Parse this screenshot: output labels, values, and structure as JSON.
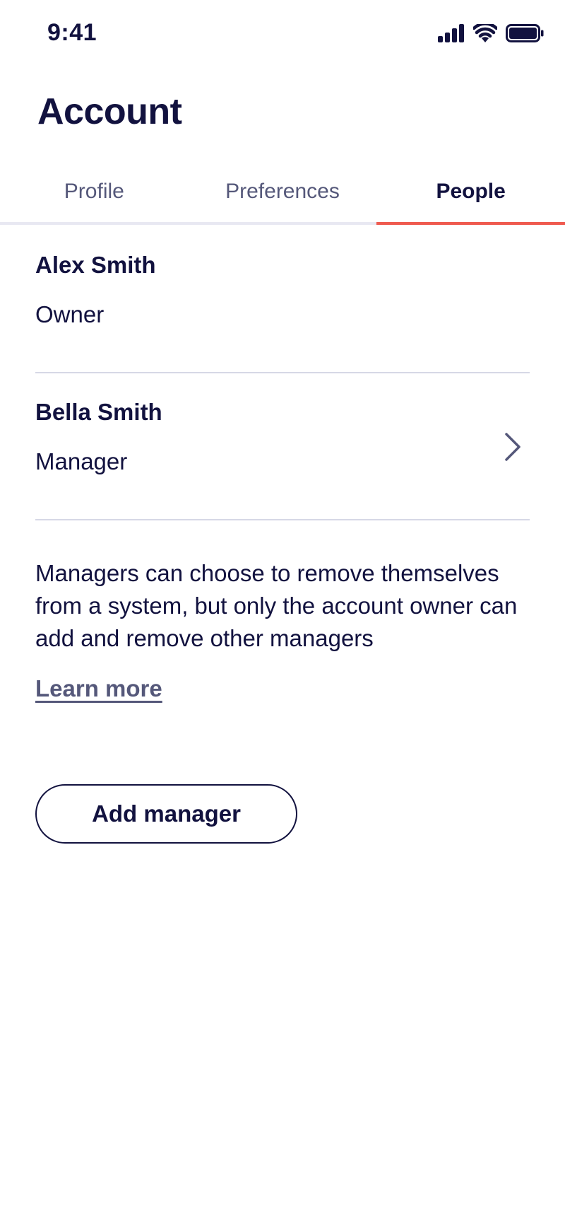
{
  "status_bar": {
    "time": "9:41",
    "icons": [
      "signal-icon",
      "wifi-icon",
      "battery-icon"
    ]
  },
  "header": {
    "title": "Account"
  },
  "tabs": [
    {
      "label": "Profile",
      "active": false
    },
    {
      "label": "Preferences",
      "active": false
    },
    {
      "label": "People",
      "active": true
    }
  ],
  "people": [
    {
      "name": "Alex Smith",
      "role": "Owner",
      "has_chevron": false
    },
    {
      "name": "Bella Smith",
      "role": "Manager",
      "has_chevron": true
    }
  ],
  "info": {
    "text": "Managers can choose to remove themselves from a system, but only the account owner can add and remove other managers",
    "link_label": "Learn more"
  },
  "actions": {
    "add_manager_label": "Add manager"
  },
  "colors": {
    "text_primary": "#12123f",
    "text_secondary": "#55587a",
    "accent": "#ef5a4f",
    "divider": "#d6d8e6"
  }
}
